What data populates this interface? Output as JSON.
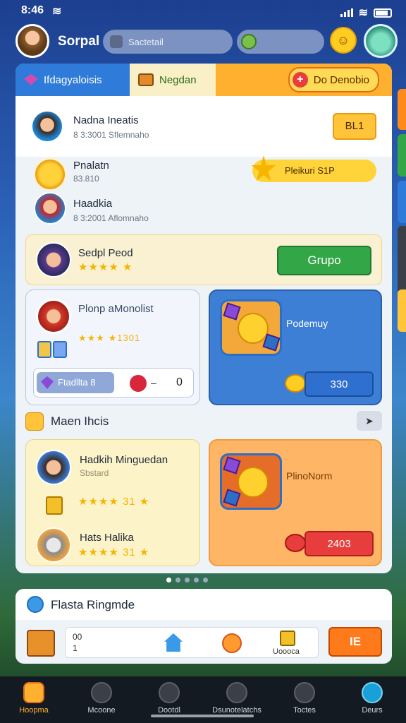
{
  "status": {
    "time": "8:46"
  },
  "header": {
    "player_name": "Sorpal",
    "search_placeholder": "Sactetail"
  },
  "tabs": [
    {
      "label": "Ifdagyaloisis"
    },
    {
      "label": "Negdan"
    },
    {
      "label": "Do Denobio"
    }
  ],
  "friends": [
    {
      "name": "Nadna Ineatis",
      "sub": "8 3:3001 Sflemnaho",
      "action": "BL1"
    },
    {
      "name": "Pnalatn",
      "sub": "83.810",
      "reward": "Pleikuri",
      "reward_value": "S1P"
    },
    {
      "name": "Haadkia",
      "sub": "8 3:2001 Aflomnaho"
    }
  ],
  "special_event": {
    "name": "Sedpl Peod",
    "stars": "★★★★ ★",
    "button": "Grupo"
  },
  "card_player": {
    "title": "Plonp aMonolist",
    "stars": "★★★ ★1301",
    "boost_label": "Ftadllta",
    "boost_value": "8",
    "dash": "–",
    "count": "0"
  },
  "card_blue": {
    "label": "Podemuy",
    "price": "330"
  },
  "section": {
    "title": "Maen Ihcis"
  },
  "card_list": {
    "line1": "Hadkih Minguedan",
    "line1sub": "Sbstard",
    "stars1": "★★★★ 31 ★",
    "line2": "Hats Halika",
    "stars2": "★★★★ 31 ★"
  },
  "card_orange": {
    "label": "PlinoNorm",
    "price": "2403"
  },
  "daily": {
    "title": "Flasta Ringmde",
    "coin_value": "00",
    "coin_sub": "1",
    "gift_label": "Uoooca",
    "claim": "IE"
  },
  "nav": [
    {
      "label": "Hoopma"
    },
    {
      "label": "Mcoone"
    },
    {
      "label": "Dootdl"
    },
    {
      "label": "Dsunotelatchs"
    },
    {
      "label": "Toctes"
    },
    {
      "label": "Deurs"
    }
  ],
  "colors": {
    "accent_blue": "#2f7bd9",
    "accent_orange": "#ffb02e",
    "accent_green": "#33a647",
    "nav_bg": "#141a22"
  }
}
